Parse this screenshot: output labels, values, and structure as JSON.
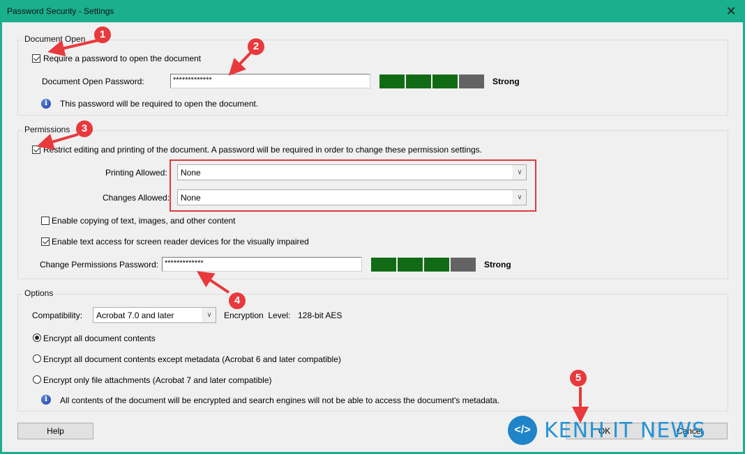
{
  "window": {
    "title": "Password Security - Settings",
    "close_icon": "close-icon"
  },
  "document_open": {
    "legend": "Document Open",
    "require_password_label": "Require a password to open the document",
    "require_password_checked": true,
    "password_label": "Document Open Password:",
    "password_value": "*************",
    "strength": {
      "filled_segments": 3,
      "total_segments": 4,
      "label": "Strong"
    },
    "info_text": "This password will be required to open the document."
  },
  "permissions": {
    "legend": "Permissions",
    "restrict_label": "Restrict editing and printing of the document. A password will be required in order to change these permission settings.",
    "restrict_checked": true,
    "printing_label": "Printing Allowed:",
    "printing_value": "None",
    "changes_label": "Changes Allowed:",
    "changes_value": "None",
    "enable_copying_label": "Enable copying of text, images, and other content",
    "enable_copying_checked": false,
    "screen_reader_label": "Enable text access for screen reader devices for the visually impaired",
    "screen_reader_checked": true,
    "password_label": "Change Permissions Password:",
    "password_value": "*************",
    "strength": {
      "filled_segments": 3,
      "total_segments": 4,
      "label": "Strong"
    }
  },
  "options": {
    "legend": "Options",
    "compatibility_label": "Compatibility:",
    "compatibility_value": "Acrobat 7.0 and later",
    "encryption_label": "Encryption  Level:",
    "encryption_value": "128-bit AES",
    "radios": [
      {
        "label": "Encrypt all document contents",
        "selected": true
      },
      {
        "label": "Encrypt all document contents except metadata (Acrobat 6 and later compatible)",
        "selected": false
      },
      {
        "label": "Encrypt only file attachments (Acrobat 7 and later compatible)",
        "selected": false
      }
    ],
    "info_text": "All contents of the document will be encrypted and search engines will not be able to access the document's metadata."
  },
  "buttons": {
    "help": "Help",
    "ok": "OK",
    "cancel": "Cancel"
  },
  "annotations": [
    "1",
    "2",
    "3",
    "4",
    "5"
  ],
  "colors": {
    "strength_on": "#116b15",
    "strength_off": "#636363",
    "annotation_red": "#e8393c",
    "titlebar": "#1aaf8d"
  },
  "watermark": {
    "text": "KENH IT NEWS",
    "logo": "</>"
  }
}
